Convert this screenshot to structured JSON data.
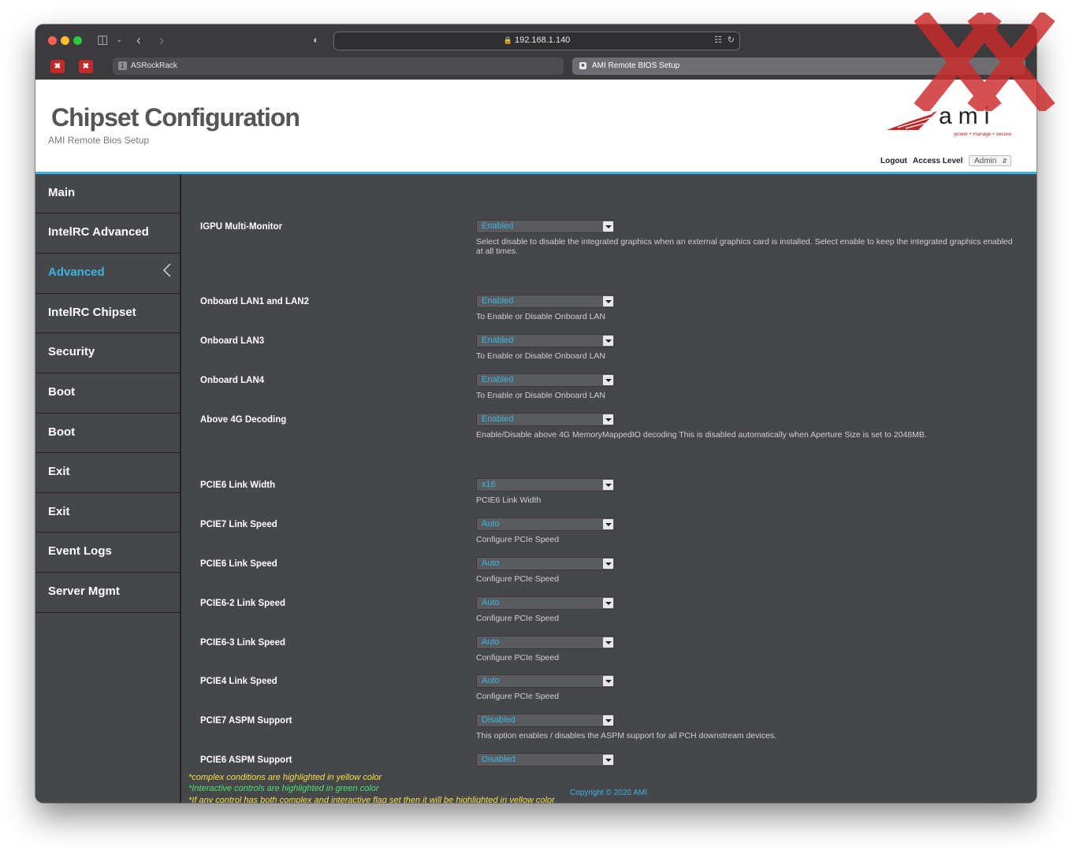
{
  "browser": {
    "url": "192.168.1.140",
    "tabs": [
      {
        "number": "1",
        "label": "ASRockRack"
      },
      {
        "label": "AMI Remote BIOS Setup"
      }
    ]
  },
  "header": {
    "title": "Chipset Configuration",
    "subtitle": "AMI Remote Bios Setup",
    "logo_brand": "ami",
    "logo_tagline": "power • manage • secure",
    "logout_label": "Logout",
    "access_level_label": "Access Level",
    "access_level_value": "Admin"
  },
  "sidebar": {
    "items": [
      {
        "label": "Main"
      },
      {
        "label": "IntelRC Advanced"
      },
      {
        "label": "Advanced",
        "active": true
      },
      {
        "label": "IntelRC Chipset"
      },
      {
        "label": "Security"
      },
      {
        "label": "Boot"
      },
      {
        "label": "Boot"
      },
      {
        "label": "Exit"
      },
      {
        "label": "Exit"
      },
      {
        "label": "Event Logs"
      },
      {
        "label": "Server Mgmt"
      }
    ]
  },
  "settings": [
    {
      "label": "IGPU Multi-Monitor",
      "value": "Enabled",
      "help": "Select disable to disable the integrated graphics when an external graphics card is installed. Select enable to keep the integrated graphics enabled at all times."
    },
    {
      "label": "Onboard LAN1 and LAN2",
      "value": "Enabled",
      "help": "To Enable or Disable Onboard LAN"
    },
    {
      "label": "Onboard LAN3",
      "value": "Enabled",
      "help": "To Enable or Disable Onboard LAN"
    },
    {
      "label": "Onboard LAN4",
      "value": "Enabled",
      "help": "To Enable or Disable Onboard LAN"
    },
    {
      "label": "Above 4G Decoding",
      "value": "Enabled",
      "help": "Enable/Disable above 4G MemoryMappedIO decoding This is disabled automatically when Aperture Size is set to 2048MB."
    },
    {
      "label": "PCIE6 Link Width",
      "value": "x16",
      "help": "PCIE6 Link Width"
    },
    {
      "label": "PCIE7 Link Speed",
      "value": "Auto",
      "help": "Configure PCIe Speed"
    },
    {
      "label": "PCIE6 Link Speed",
      "value": "Auto",
      "help": "Configure PCIe Speed"
    },
    {
      "label": "PCIE6-2 Link Speed",
      "value": "Auto",
      "help": "Configure PCIe Speed"
    },
    {
      "label": "PCIE6-3 Link Speed",
      "value": "Auto",
      "help": "Configure PCIe Speed"
    },
    {
      "label": "PCIE4 Link Speed",
      "value": "Auto",
      "help": "Configure PCIe Speed"
    },
    {
      "label": "PCIE7 ASPM Support",
      "value": "Disabled",
      "help": "This option enables / disables the ASPM support for all PCH downstream devices."
    },
    {
      "label": "PCIE6 ASPM Support",
      "value": "Disabled",
      "help": ""
    }
  ],
  "notes": [
    "*complex conditions are highlighted in yellow color",
    "*Interactive controls are highlighted in green color",
    "*If any control has both complex and interactive flag set then it will be highlighted in yellow color"
  ],
  "footer": {
    "copyright": "Copyright © 2020 AMI"
  },
  "colors": {
    "accent": "#3ab5e0",
    "panel": "#46474b",
    "complex_note": "#f5e048",
    "interactive_note": "#4de06d",
    "watermark": "#cc2a2a"
  }
}
